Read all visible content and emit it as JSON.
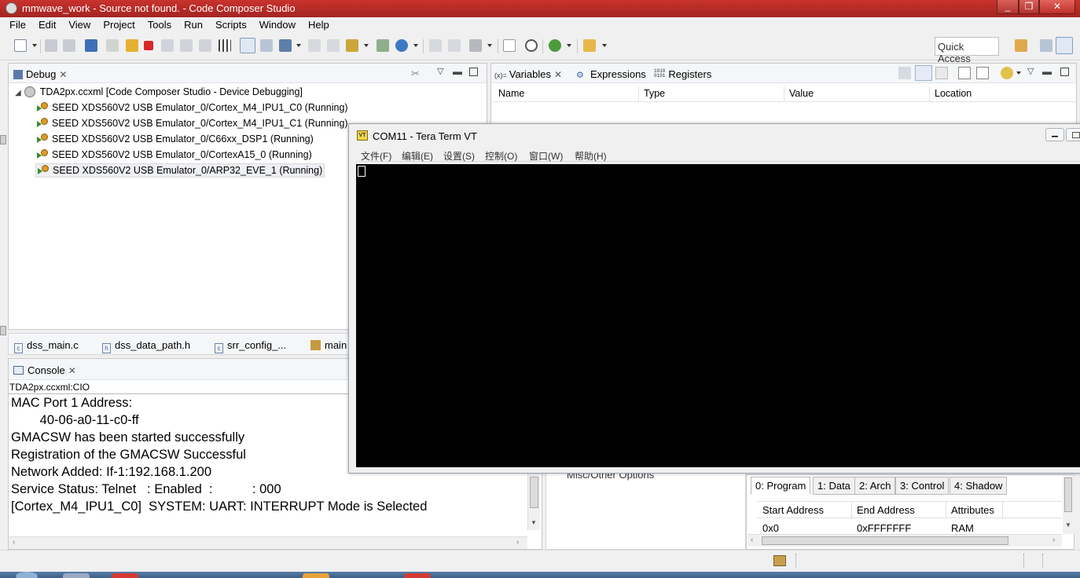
{
  "window": {
    "title": "mmwave_work - Source not found. - Code Composer Studio",
    "buttons": [
      "_",
      "❐",
      "✕"
    ]
  },
  "menu": [
    "File",
    "Edit",
    "View",
    "Project",
    "Tools",
    "Run",
    "Scripts",
    "Window",
    "Help"
  ],
  "toolbar": {
    "quick_access_label": "Quick Access"
  },
  "debug_view": {
    "tab_label": "Debug",
    "root": "TDA2px.ccxml [Code Composer Studio - Device Debugging]",
    "threads": [
      "SEED XDS560V2 USB Emulator_0/Cortex_M4_IPU1_C0 (Running)",
      "SEED XDS560V2 USB Emulator_0/Cortex_M4_IPU1_C1 (Running)",
      "SEED XDS560V2 USB Emulator_0/C66xx_DSP1 (Running)",
      "SEED XDS560V2 USB Emulator_0/CortexA15_0 (Running)",
      "SEED XDS560V2 USB Emulator_0/ARP32_EVE_1 (Running)"
    ]
  },
  "variables_view": {
    "tabs": [
      "Variables",
      "Expressions",
      "Registers"
    ],
    "tab_prefixes": [
      "(x)=",
      "",
      "1010\n0101"
    ],
    "columns": [
      "Name",
      "Type",
      "Value",
      "Location"
    ]
  },
  "editor_tabs": [
    "dss_main.c",
    "dss_data_path.h",
    "srr_config_...",
    "main"
  ],
  "console": {
    "tab_label": "Console",
    "source": "TDA2px.ccxml:CIO",
    "lines": [
      "MAC Port 1 Address:",
      "        40-06-a0-11-c0-ff",
      "GMACSW has been started successfully",
      "Registration of the GMACSW Successful",
      "Network Added: If-1:192.168.1.200",
      "Service Status: Telnet   : Enabled  :           : 000",
      "[Cortex_M4_IPU1_C0]  SYSTEM: UART: INTERRUPT Mode is Selected"
    ]
  },
  "teraterm": {
    "icon_label": "VT",
    "title": "COM11 - Tera Term VT",
    "menu": [
      "文件(F)",
      "编辑(E)",
      "设置(S)",
      "控制(O)",
      "窗口(W)",
      "帮助(H)"
    ]
  },
  "misc_options_label": "Misc/Other Options",
  "memory_map": {
    "tabs": [
      "0: Program",
      "1: Data",
      "2: Arch",
      "3: Control",
      "4: Shadow"
    ],
    "columns": [
      "Start Address",
      "End Address",
      "Attributes"
    ],
    "rows": [
      [
        "0x0",
        "0xFFFFFFF",
        "RAM"
      ]
    ]
  },
  "colors": {
    "title_bar": "#b8302a",
    "terminal_bg": "#000000",
    "panel_bg": "#ffffff"
  }
}
